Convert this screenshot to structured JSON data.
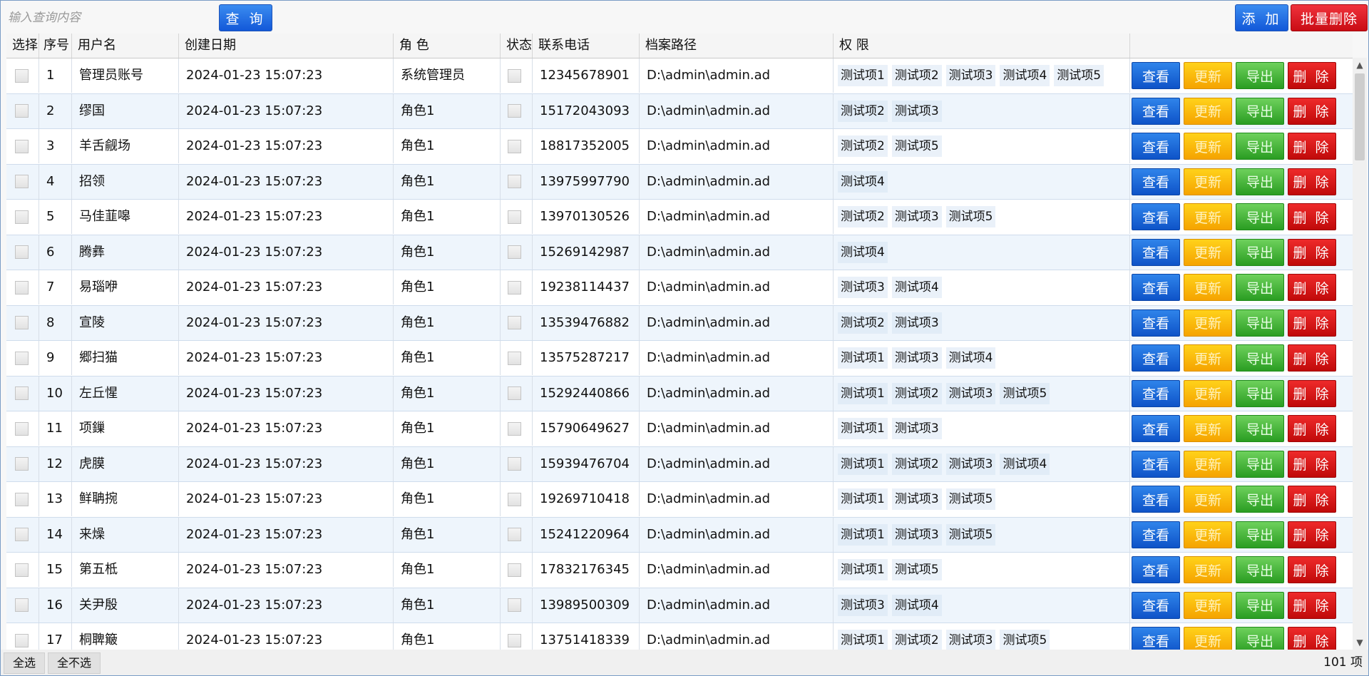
{
  "toolbar": {
    "search_placeholder": "输入查询内容",
    "query_label": "查 询",
    "add_label": "添 加",
    "batch_delete_label": "批量删除"
  },
  "table": {
    "headers": [
      "选择",
      "序号",
      "用户名",
      "创建日期",
      "角 色",
      "状态",
      "联系电话",
      "档案路径",
      "权 限",
      ""
    ],
    "action_labels": {
      "view": "查看",
      "update": "更新",
      "export": "导出",
      "delete": "删 除"
    },
    "rows": [
      {
        "no": "1",
        "username": "管理员账号",
        "created": "2024-01-23 15:07:23",
        "role": "系统管理员",
        "phone": "12345678901",
        "path": "D:\\admin\\admin.ad",
        "permissions": [
          "测试项1",
          "测试项2",
          "测试项3",
          "测试项4",
          "测试项5"
        ]
      },
      {
        "no": "2",
        "username": "缪国",
        "created": "2024-01-23 15:07:23",
        "role": "角色1",
        "phone": "15172043093",
        "path": "D:\\admin\\admin.ad",
        "permissions": [
          "测试项2",
          "测试项3"
        ]
      },
      {
        "no": "3",
        "username": "羊舌觎场",
        "created": "2024-01-23 15:07:23",
        "role": "角色1",
        "phone": "18817352005",
        "path": "D:\\admin\\admin.ad",
        "permissions": [
          "测试项2",
          "测试项5"
        ]
      },
      {
        "no": "4",
        "username": "招领",
        "created": "2024-01-23 15:07:23",
        "role": "角色1",
        "phone": "13975997790",
        "path": "D:\\admin\\admin.ad",
        "permissions": [
          "测试项4"
        ]
      },
      {
        "no": "5",
        "username": "马佳韮嗥",
        "created": "2024-01-23 15:07:23",
        "role": "角色1",
        "phone": "13970130526",
        "path": "D:\\admin\\admin.ad",
        "permissions": [
          "测试项2",
          "测试项3",
          "测试项5"
        ]
      },
      {
        "no": "6",
        "username": "腾彝",
        "created": "2024-01-23 15:07:23",
        "role": "角色1",
        "phone": "15269142987",
        "path": "D:\\admin\\admin.ad",
        "permissions": [
          "测试项4"
        ]
      },
      {
        "no": "7",
        "username": "易瑙咿",
        "created": "2024-01-23 15:07:23",
        "role": "角色1",
        "phone": "19238114437",
        "path": "D:\\admin\\admin.ad",
        "permissions": [
          "测试项3",
          "测试项4"
        ]
      },
      {
        "no": "8",
        "username": "宣陵",
        "created": "2024-01-23 15:07:23",
        "role": "角色1",
        "phone": "13539476882",
        "path": "D:\\admin\\admin.ad",
        "permissions": [
          "测试项2",
          "测试项3"
        ]
      },
      {
        "no": "9",
        "username": "郷扫猫",
        "created": "2024-01-23 15:07:23",
        "role": "角色1",
        "phone": "13575287217",
        "path": "D:\\admin\\admin.ad",
        "permissions": [
          "测试项1",
          "测试项3",
          "测试项4"
        ]
      },
      {
        "no": "10",
        "username": "左丘惺",
        "created": "2024-01-23 15:07:23",
        "role": "角色1",
        "phone": "15292440866",
        "path": "D:\\admin\\admin.ad",
        "permissions": [
          "测试项1",
          "测试项2",
          "测试项3",
          "测试项5"
        ]
      },
      {
        "no": "11",
        "username": "项鏁",
        "created": "2024-01-23 15:07:23",
        "role": "角色1",
        "phone": "15790649627",
        "path": "D:\\admin\\admin.ad",
        "permissions": [
          "测试项1",
          "测试项3"
        ]
      },
      {
        "no": "12",
        "username": "虎膜",
        "created": "2024-01-23 15:07:23",
        "role": "角色1",
        "phone": "15939476704",
        "path": "D:\\admin\\admin.ad",
        "permissions": [
          "测试项1",
          "测试项2",
          "测试项3",
          "测试项4"
        ]
      },
      {
        "no": "13",
        "username": "鲜聃捥",
        "created": "2024-01-23 15:07:23",
        "role": "角色1",
        "phone": "19269710418",
        "path": "D:\\admin\\admin.ad",
        "permissions": [
          "测试项1",
          "测试项3",
          "测试项5"
        ]
      },
      {
        "no": "14",
        "username": "来燥",
        "created": "2024-01-23 15:07:23",
        "role": "角色1",
        "phone": "15241220964",
        "path": "D:\\admin\\admin.ad",
        "permissions": [
          "测试项1",
          "测试项3",
          "测试项5"
        ]
      },
      {
        "no": "15",
        "username": "第五柢",
        "created": "2024-01-23 15:07:23",
        "role": "角色1",
        "phone": "17832176345",
        "path": "D:\\admin\\admin.ad",
        "permissions": [
          "测试项1",
          "测试项5"
        ]
      },
      {
        "no": "16",
        "username": "关尹殷",
        "created": "2024-01-23 15:07:23",
        "role": "角色1",
        "phone": "13989500309",
        "path": "D:\\admin\\admin.ad",
        "permissions": [
          "测试项3",
          "测试项4"
        ]
      },
      {
        "no": "17",
        "username": "桐聛簸",
        "created": "2024-01-23 15:07:23",
        "role": "角色1",
        "phone": "13751418339",
        "path": "D:\\admin\\admin.ad",
        "permissions": [
          "测试项1",
          "测试项2",
          "测试项3",
          "测试项5"
        ]
      }
    ]
  },
  "footer": {
    "select_all_label": "全选",
    "select_none_label": "全不选",
    "count_label": "101 项"
  },
  "icons": {
    "scroll_up": "scroll-up-arrow-icon",
    "scroll_down": "scroll-down-arrow-icon"
  },
  "colors": {
    "view": "#1565d8",
    "update": "#f8b400",
    "export": "#3db52f",
    "delete": "#d01010",
    "row_alt": "#eef5fc"
  }
}
